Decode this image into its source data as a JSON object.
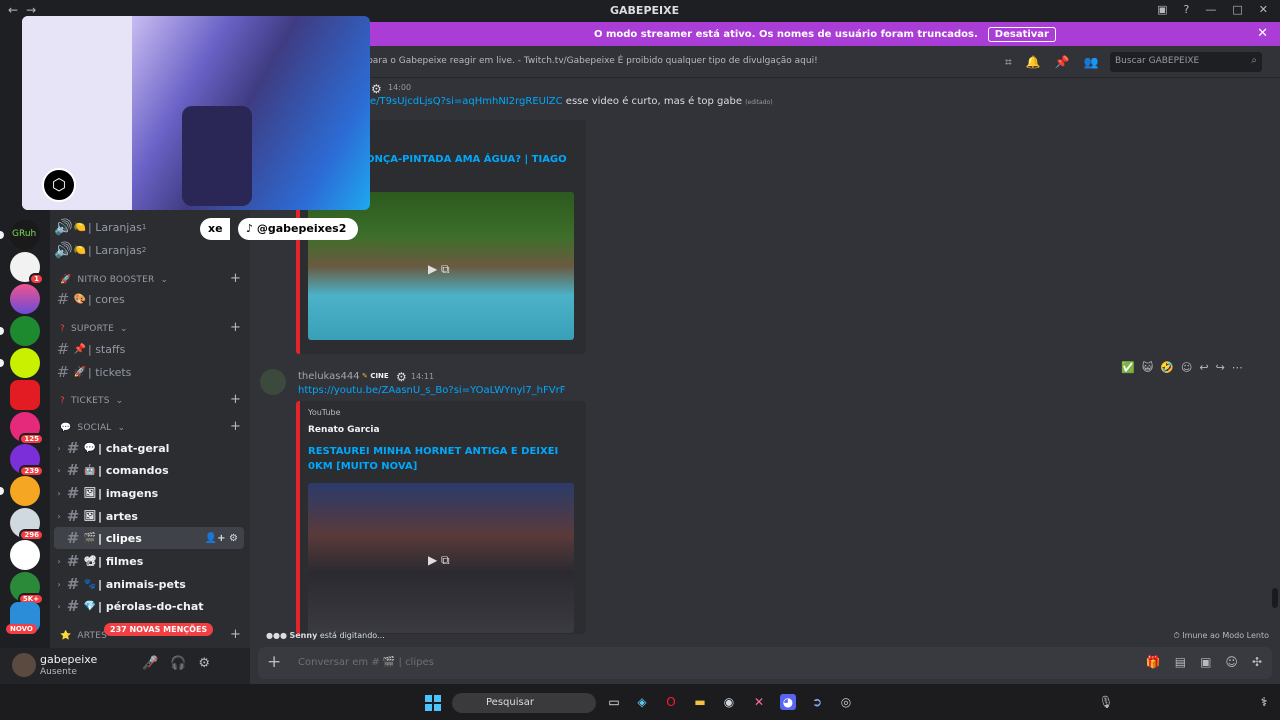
{
  "window": {
    "title": "GABEPEIXE",
    "back": "←",
    "forward": "→"
  },
  "banner": {
    "text": "O modo streamer está ativo. Os nomes de usuário foram truncados.",
    "button": "Desativar"
  },
  "servers": {
    "badges": [
      "1",
      "125",
      "239",
      "296",
      "5K+"
    ],
    "novo": "NOVO"
  },
  "channels": {
    "items": [
      {
        "emoji": "🍋",
        "label": "| Laranjas",
        "sup": "1"
      },
      {
        "emoji": "🍋",
        "label": "| Laranjas",
        "sup": "2"
      }
    ],
    "categories": [
      "NITRO BOOSTER",
      "SUPORTE",
      "TICKETS",
      "SOCIAL",
      "ARTES"
    ],
    "nitro": [
      {
        "label": "| cores"
      }
    ],
    "suporte": [
      {
        "label": "| staffs"
      },
      {
        "label": "| tickets"
      }
    ],
    "social": [
      {
        "label": "| chat-geral"
      },
      {
        "label": "| comandos"
      },
      {
        "label": "| imagens"
      },
      {
        "label": "| artes"
      },
      {
        "label": "| clipes"
      },
      {
        "label": "| filmes"
      },
      {
        "label": "| animais-pets"
      },
      {
        "label": "| pérolas-do-chat"
      }
    ],
    "mentions": "237 NOVAS MENÇÕES"
  },
  "user": {
    "name": "gabepeixe",
    "status": "Ausente"
  },
  "topic": {
    "text": "es para o Gabepeixe reagir em live. - Twitch.tv/Gabepeixe É proibido qualquer tipo de divulgação aqui!",
    "search_placeholder": "Buscar GABEPEIXE"
  },
  "messages": [
    {
      "time": "14:00",
      "link": "e/T9sUjcdLjsQ?si=aqHmhNI2rgREUlZC",
      "text": "esse video é curto, mas é top gabe",
      "edited": "(editado)",
      "embed_title": "ONÇA-PINTADA AMA ÁGUA? | TIAGO"
    },
    {
      "author": "thelukas444",
      "tag": "CINE",
      "time": "14:11",
      "link": "https://youtu.be/ZAasnU_s_Bo?si=YOaLWYnyl7_hFVrF",
      "provider": "YouTube",
      "channel": "Renato Garcia",
      "embed_title": "RESTAUREI MINHA HORNET ANTIGA E DEIXEI 0KM [MUITO NOVA]"
    }
  ],
  "tiktok": {
    "handle": "@gabepeixes2",
    "partial": "xe"
  },
  "typing": {
    "name": "Senny",
    "suffix": "está digitando..."
  },
  "slowmode": "Imune ao Modo Lento",
  "composer": {
    "placeholder": "Conversar em #",
    "channel": "| clipes"
  },
  "taskbar": {
    "search_placeholder": "Pesquisar"
  }
}
